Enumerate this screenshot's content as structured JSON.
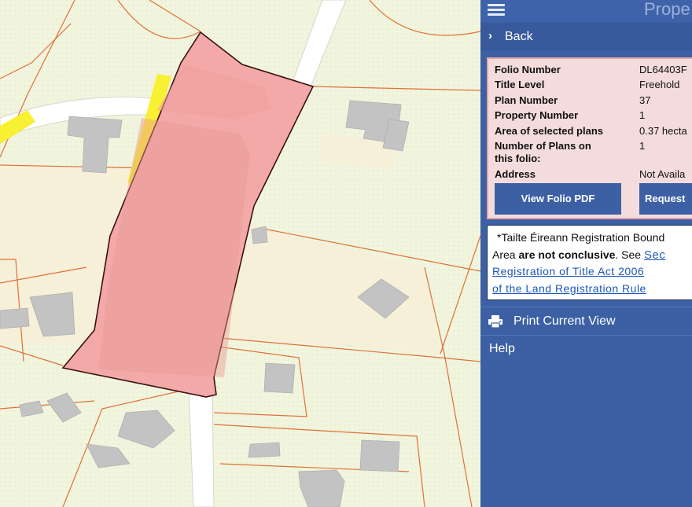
{
  "header": {
    "title": "Prope",
    "menu_icon": "hamburger-menu-icon"
  },
  "nav": {
    "back_label": "Back",
    "back_icon": "chevron-right-icon"
  },
  "property_info": {
    "rows": [
      {
        "label": "Folio Number",
        "value": "DL64403F"
      },
      {
        "label": "Title Level",
        "value": "Freehold"
      },
      {
        "label": "Plan Number",
        "value": "37"
      },
      {
        "label": "Property Number",
        "value": "1"
      },
      {
        "label": "Area of selected plans",
        "value": "0.37 hecta"
      },
      {
        "label": "Number of Plans on",
        "label_line2": "this folio:",
        "value": "1"
      },
      {
        "label": "Address",
        "value": "Not Availa"
      }
    ],
    "view_pdf_label": "View Folio PDF",
    "request_label": "Request"
  },
  "disclaimer": {
    "line1": "*Tailte Éireann Registration Bound",
    "line2_pre": "Area ",
    "line2_bold": "are not conclusive",
    "line2_post": ". See ",
    "line2_link": "Sec",
    "line3_link": "Registration of Title Act 2006",
    "line4_link": "of the Land Registration Rule"
  },
  "actions": {
    "print_label": "Print Current View",
    "print_icon": "printer-icon",
    "help_label": "Help"
  },
  "colors": {
    "panel_bg": "#3d60a5",
    "parcel_fill": "#f2a9a8",
    "parcel_outline": "#3a1010",
    "map_bg": "#f2f6df",
    "boundary": "#e0703a",
    "highlight": "#f8f032",
    "building": "#c3c3c3"
  }
}
